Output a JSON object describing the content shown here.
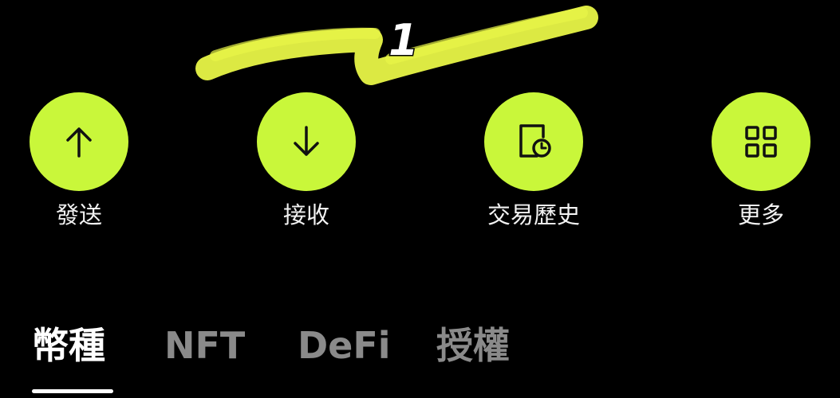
{
  "colors": {
    "accent": "#c9f73a",
    "background": "#000000",
    "tab_active": "#ffffff",
    "tab_inactive": "#8a8a8a",
    "highlight_scribble": "#e8f547"
  },
  "annotation": {
    "number": "1"
  },
  "actions": [
    {
      "label": "發送",
      "icon": "arrow-up-icon"
    },
    {
      "label": "接收",
      "icon": "arrow-down-icon"
    },
    {
      "label": "交易歷史",
      "icon": "history-icon"
    },
    {
      "label": "更多",
      "icon": "grid-icon"
    }
  ],
  "tabs": [
    {
      "label": "幣種",
      "active": true
    },
    {
      "label": "NFT",
      "active": false
    },
    {
      "label": "DeFi",
      "active": false
    },
    {
      "label": "授權",
      "active": false
    }
  ]
}
